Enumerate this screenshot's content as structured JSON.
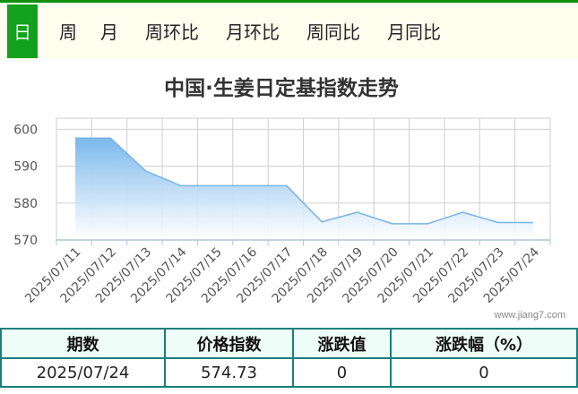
{
  "tabs": [
    {
      "label": "日",
      "active": true
    },
    {
      "label": "周",
      "active": false
    },
    {
      "label": "月",
      "active": false
    },
    {
      "label": "周环比",
      "active": false
    },
    {
      "label": "月环比",
      "active": false
    },
    {
      "label": "周同比",
      "active": false
    },
    {
      "label": "月同比",
      "active": false
    }
  ],
  "watermark": "www.jiang7.com",
  "chart_data": {
    "type": "area",
    "title": "中国·生姜日定基指数走势",
    "xlabel": "",
    "ylabel": "",
    "categories": [
      "2025/07/11",
      "2025/07/12",
      "2025/07/13",
      "2025/07/14",
      "2025/07/15",
      "2025/07/16",
      "2025/07/17",
      "2025/07/18",
      "2025/07/19",
      "2025/07/20",
      "2025/07/21",
      "2025/07/22",
      "2025/07/23",
      "2025/07/24"
    ],
    "values": [
      597.6,
      597.6,
      588.7,
      584.7,
      584.7,
      584.7,
      584.7,
      574.9,
      577.5,
      574.4,
      574.4,
      577.5,
      574.73,
      574.73
    ],
    "yticks": [
      570,
      580,
      590,
      600
    ],
    "ylim": [
      570,
      603
    ],
    "grid": true,
    "legend": "none",
    "colors": {
      "line": "#7ab3e6",
      "fill_top": "#7ab8ec",
      "fill_bottom": "#ffffff",
      "grid": "#cfcfcf"
    }
  },
  "summary": {
    "headers": [
      "期数",
      "价格指数",
      "涨跌值",
      "涨跌幅（%）"
    ],
    "row": [
      "2025/07/24",
      "574.73",
      "0",
      "0"
    ]
  },
  "colors": {
    "tab_active_bg": "#12a21d",
    "tab_bar_bg": "#fffff0",
    "table_border": "#1a7f7a",
    "table_header_bg": "#eefdf7"
  }
}
